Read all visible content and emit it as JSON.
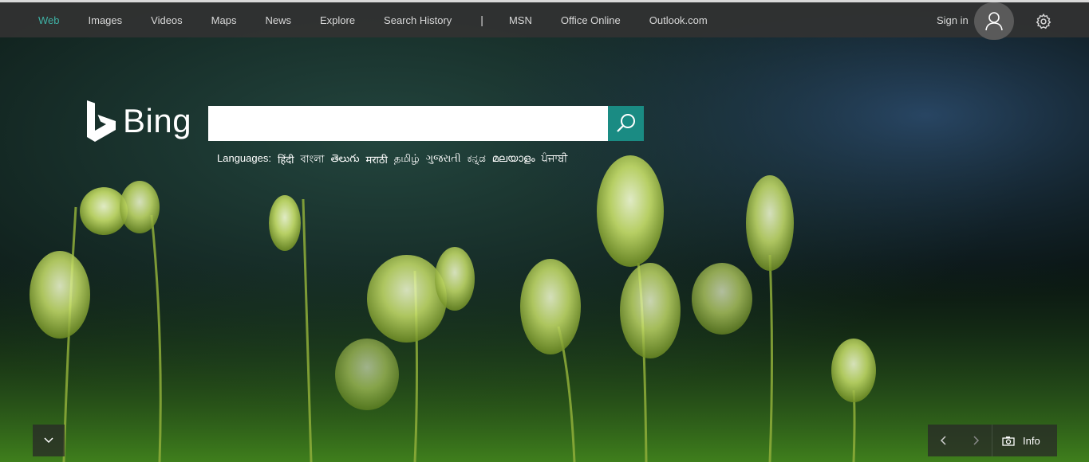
{
  "nav": {
    "items": [
      {
        "label": "Web",
        "active": true
      },
      {
        "label": "Images"
      },
      {
        "label": "Videos"
      },
      {
        "label": "Maps"
      },
      {
        "label": "News"
      },
      {
        "label": "Explore"
      },
      {
        "label": "Search History"
      }
    ],
    "divider": "|",
    "external": [
      {
        "label": "MSN"
      },
      {
        "label": "Office Online"
      },
      {
        "label": "Outlook.com"
      }
    ]
  },
  "account": {
    "signin_label": "Sign in"
  },
  "logo": {
    "text": "Bing"
  },
  "search": {
    "value": "",
    "placeholder": ""
  },
  "languages": {
    "label": "Languages:",
    "items": [
      "हिंदी",
      "বাংলা",
      "తెలుగు",
      "मराठी",
      "தமிழ்",
      "ગુજરાતી",
      "ಕನ್ನಡ",
      "മലയാളം",
      "ਪੰਜਾਬੀ"
    ]
  },
  "image_controls": {
    "info_label": "Info"
  },
  "colors": {
    "accent": "#1a8b83",
    "active_nav": "#3fb0a4",
    "topbar": "#323232"
  }
}
